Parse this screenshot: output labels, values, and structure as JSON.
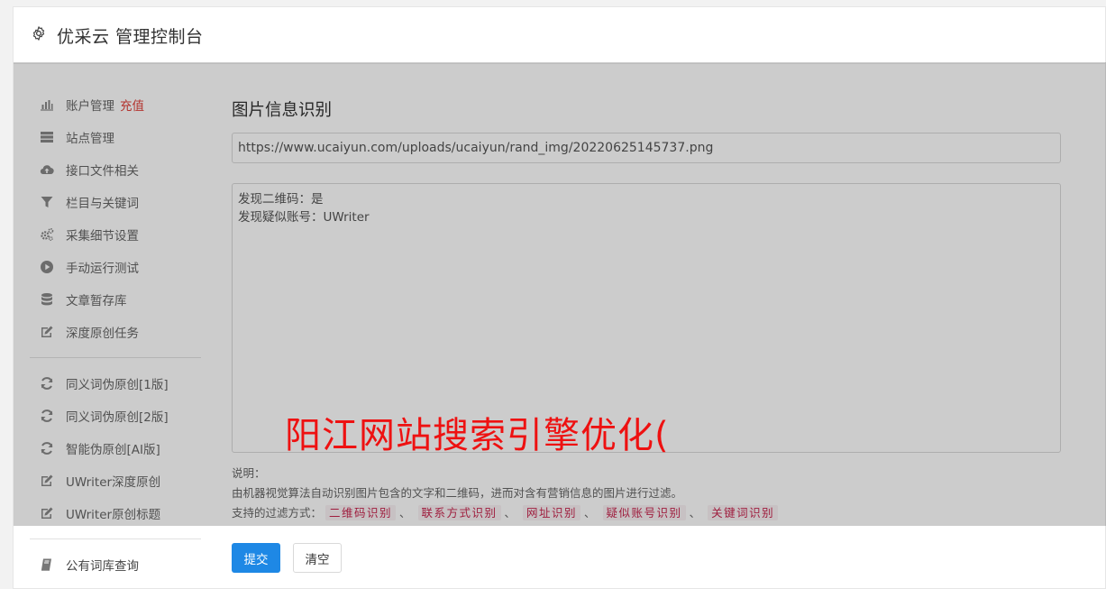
{
  "header": {
    "title": "优采云 管理控制台",
    "icon": "gear-icon"
  },
  "sidebar": {
    "group1": [
      {
        "label": "账户管理",
        "icon": "bar-chart-icon",
        "badge": "充值"
      },
      {
        "label": "站点管理",
        "icon": "server-icon"
      },
      {
        "label": "接口文件相关",
        "icon": "cloud-upload-icon"
      },
      {
        "label": "栏目与关键词",
        "icon": "filter-icon"
      },
      {
        "label": "采集细节设置",
        "icon": "cogs-icon"
      },
      {
        "label": "手动运行测试",
        "icon": "play-circle-icon"
      },
      {
        "label": "文章暂存库",
        "icon": "database-icon"
      },
      {
        "label": "深度原创任务",
        "icon": "edit-icon"
      }
    ],
    "group2": [
      {
        "label": "同义词伪原创[1版]",
        "icon": "refresh-icon"
      },
      {
        "label": "同义词伪原创[2版]",
        "icon": "refresh-icon"
      },
      {
        "label": "智能伪原创[AI版]",
        "icon": "refresh-icon"
      },
      {
        "label": "UWriter深度原创",
        "icon": "edit-icon"
      },
      {
        "label": "UWriter原创标题",
        "icon": "edit-icon"
      }
    ],
    "group3": [
      {
        "label": "公有词库查询",
        "icon": "book-icon"
      }
    ]
  },
  "main": {
    "section_title": "图片信息识别",
    "url_value": "https://www.ucaiyun.com/uploads/ucaiyun/rand_img/20220625145737.png",
    "result_lines": [
      "发现二维码：是",
      "发现疑似账号：UWriter"
    ],
    "notes_title": "说明：",
    "notes_desc": "由机器视觉算法自动识别图片包含的文字和二维码，进而对含有营销信息的图片进行过滤。",
    "filter_prefix": "支持的过滤方式：",
    "filters": [
      "二维码识别",
      "联系方式识别",
      "网址识别",
      "疑似账号识别",
      "关键词识别"
    ],
    "filter_separator": "、"
  },
  "buttons": {
    "submit": "提交",
    "clear": "清空"
  },
  "watermark": "阳江网站搜索引擎优化(",
  "colors": {
    "accent": "#1e88e5",
    "badge": "#e0403a",
    "watermark": "#ee1111",
    "tag_text": "#c7254e"
  }
}
